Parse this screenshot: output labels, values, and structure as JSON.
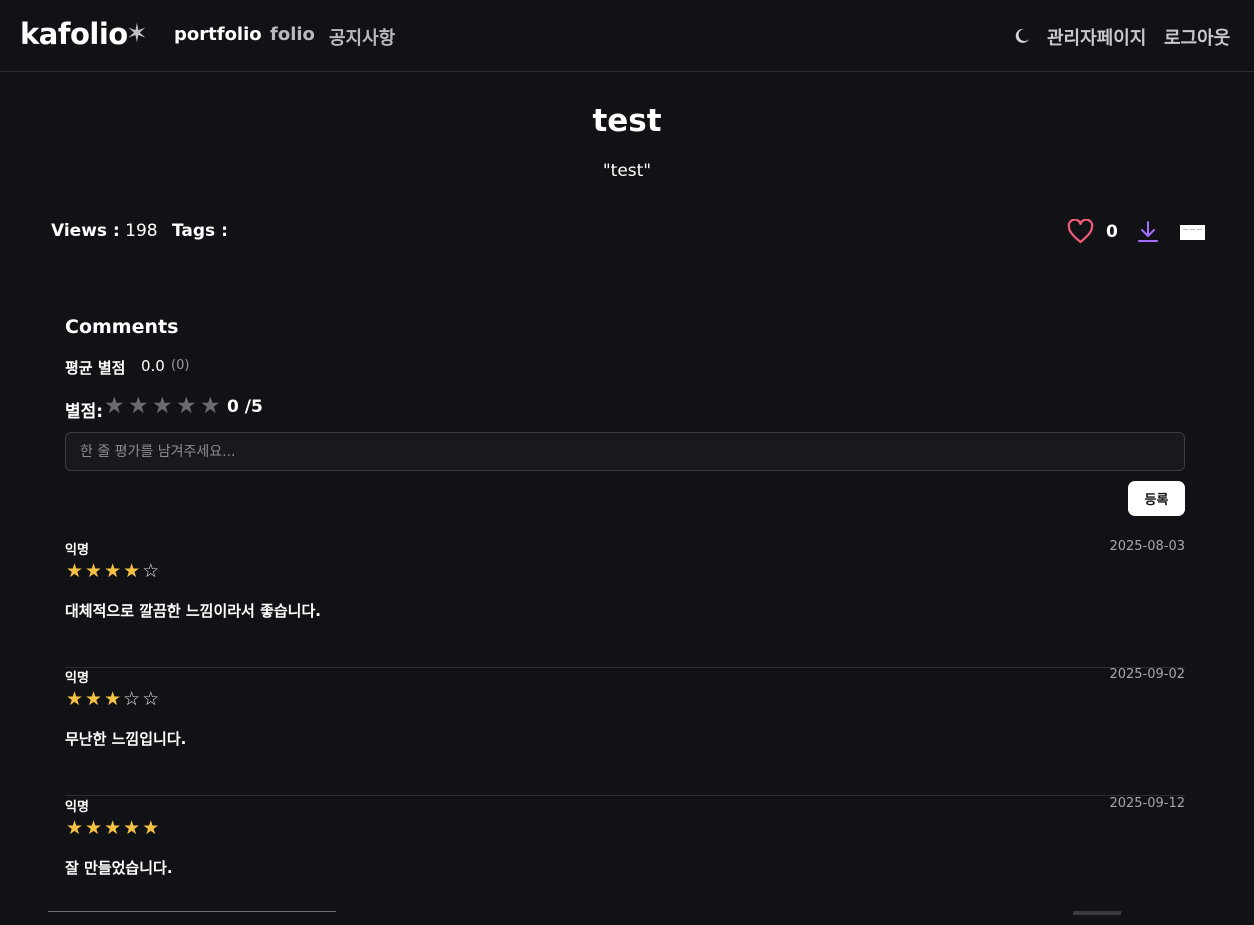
{
  "header": {
    "logo": "kafolio",
    "nav": [
      "portfolio",
      "folio",
      "공지사항"
    ],
    "admin": "관리자페이지",
    "logout": "로그아웃"
  },
  "post": {
    "title": "test",
    "subtitle": "\"test\"",
    "views_label": "Views :",
    "views": "198",
    "tags_label": "Tags :",
    "likes": "0"
  },
  "comments": {
    "heading": "Comments",
    "avg_label": "평균 별점",
    "avg_value": "0.0",
    "avg_count": "(0)",
    "rate_label": "별점:",
    "rate_value": "0 /5",
    "input_placeholder": "한 줄 평가를 남겨주세요...",
    "submit": "등록",
    "reviews": [
      {
        "author": "익명",
        "date": "2025-08-03",
        "rating": 4,
        "text": "대체적으로 깔끔한 느낌이라서 좋습니다."
      },
      {
        "author": "익명",
        "date": "2025-09-02",
        "rating": 3,
        "text": "무난한 느낌입니다."
      },
      {
        "author": "익명",
        "date": "2025-09-12",
        "rating": 5,
        "text": "잘 만들었습니다."
      }
    ]
  },
  "colors": {
    "background": "#111215",
    "star_filled": "#f6c244",
    "heart": "#f25b7a",
    "download": "#a66cff"
  },
  "icons": [
    "logo-star-icon",
    "moon-icon",
    "heart-icon",
    "download-icon",
    "share-icon",
    "star-icon"
  ]
}
